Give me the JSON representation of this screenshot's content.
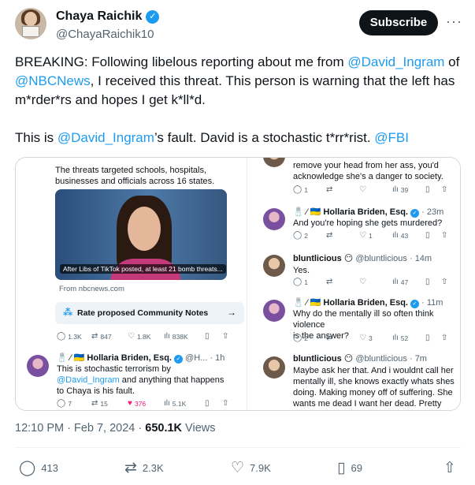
{
  "author": {
    "name": "Chaya Raichik",
    "handle": "@ChayaRaichik10"
  },
  "header": {
    "subscribe_label": "Subscribe",
    "more_label": "···"
  },
  "tweet": {
    "p1_a": "BREAKING: Following libelous reporting about me from ",
    "p1_m1": "@David_Ingram",
    "p1_b": " of ",
    "p1_m2": "@NBCNews",
    "p1_c": ", I received this threat. This person is warning that the left has m*rder*rs and hopes I get k*ll*d.",
    "p2_a": "This is ",
    "p2_m1": "@David_Ingram",
    "p2_b": "’s fault. David is a stochastic t*rr*rist. ",
    "p2_m2": "@FBI"
  },
  "media": {
    "left": {
      "headline": "The threats targeted schools, hospitals, businesses and officials across 16 states.",
      "photo_caption": "After Libs of TikTok posted, at least 21 bomb threats...",
      "source": "From nbcnews.com",
      "notes_label": "Rate proposed Community Notes",
      "stats1": {
        "replies": "1.3K",
        "reposts": "847",
        "likes": "1.8K",
        "views": "838K"
      },
      "reply": {
        "user": "Hollaria Briden, Esq.",
        "meta": "@H... · 1h",
        "line1": "This is stochastic terrorism by",
        "mention": "@David_Ingram",
        "line2b": " and anything that happens",
        "line3": "to Chaya is his fault.",
        "stats": {
          "replies": "7",
          "reposts": "15",
          "likes": "376",
          "views": "5.1K"
        }
      }
    },
    "right": {
      "top_line1": "remove your head from her ass, you'd",
      "top_line2": "acknowledge she's a danger to society.",
      "top_stats": {
        "replies": "1",
        "reposts": "",
        "likes": "",
        "views": "39"
      },
      "r1": {
        "user": "Hollaria Briden, Esq.",
        "meta": "· 23m",
        "text": "And you're hoping she gets murdered?",
        "stats": {
          "replies": "2",
          "reposts": "",
          "likes": "1",
          "views": "43"
        }
      },
      "r2": {
        "user": "bluntlicious",
        "meta": "@bluntlicious · 14m",
        "text": "Yes.",
        "stats": {
          "replies": "1",
          "reposts": "",
          "likes": "",
          "views": "47"
        }
      },
      "r3": {
        "user": "Hollaria Briden, Esq.",
        "meta": "· 11m",
        "line1": "Why do the mentally ill so often think violence",
        "line2": "is the answer?",
        "stats": {
          "replies": "2",
          "reposts": "",
          "likes": "3",
          "views": "52"
        }
      },
      "r4": {
        "user": "bluntlicious",
        "meta": "@bluntlicious · 7m",
        "line1": "Maybe ask her that. And i wouldnt call her",
        "line2": "mentally ill, she knows exactly whats shes",
        "line3": "doing. Making money off of suffering. She",
        "line4": "wants me dead I want her dead. Pretty simple"
      }
    }
  },
  "meta": {
    "time": "12:10 PM",
    "date": "Feb 7, 2024",
    "views_count": "650.1K",
    "views_label": " Views"
  },
  "actions": {
    "replies": "413",
    "reposts": "2.3K",
    "likes": "7.9K",
    "bookmarks": "69"
  },
  "colors": {
    "link": "#1d9bf0",
    "text": "#0f1419",
    "secondary": "#536471",
    "like_active": "#f91880"
  }
}
